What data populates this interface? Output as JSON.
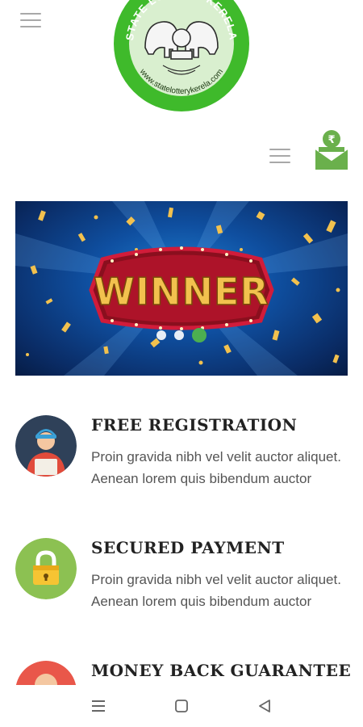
{
  "logo": {
    "top_text": "STATE LOTTERY KERELA",
    "website": "www.statelotterykerela.com"
  },
  "banner": {
    "headline": "WINNER",
    "slides": 3,
    "active_slide": 3
  },
  "features": [
    {
      "title": "FREE REGISTRATION",
      "description": "Proin gravida nibh vel velit auctor aliquet. Aenean lorem quis bibendum auctor",
      "icon": "delivery-person-icon"
    },
    {
      "title": "SECURED PAYMENT",
      "description": "Proin gravida nibh vel velit auctor aliquet. Aenean lorem quis bibendum auctor",
      "icon": "padlock-icon"
    },
    {
      "title": "MONEY BACK GUARANTEE",
      "description": "",
      "icon": "money-back-icon"
    }
  ],
  "colors": {
    "brand_green": "#3fba2b",
    "active_dot": "#4caf50",
    "wallet_green": "#6ab04c",
    "banner_blue": "#0f4fa0",
    "winner_gold": "#f2c14e"
  },
  "icons": {
    "menu": "hamburger-icon",
    "wallet": "rupee-envelope-icon",
    "nav_menu": "recent-apps-icon",
    "nav_home": "home-square-icon",
    "nav_back": "back-triangle-icon"
  }
}
